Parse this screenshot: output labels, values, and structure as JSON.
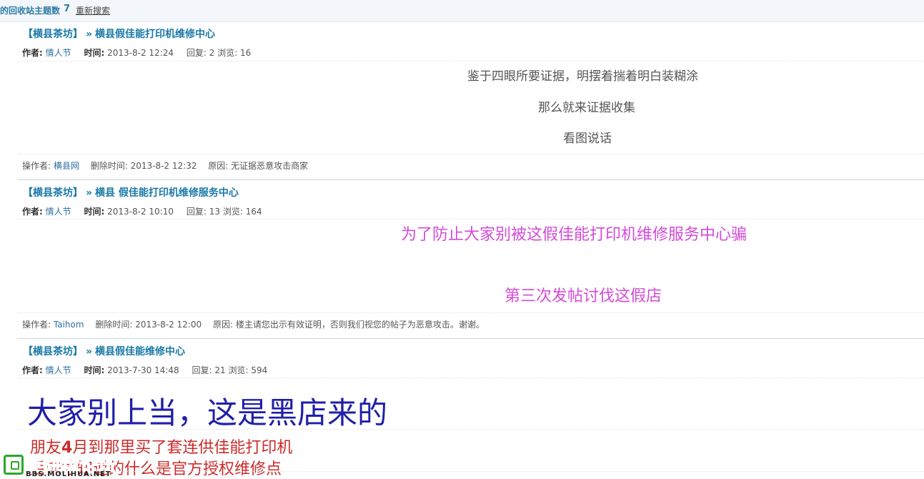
{
  "topbar": {
    "count_label": "的回收站主题数",
    "count": "7",
    "research_link": "重新搜索"
  },
  "labels": {
    "author": "作者:",
    "time": "时间:",
    "replies": "回复:",
    "views": "浏览:",
    "operator": "操作者:",
    "delete_time": "删除时间:",
    "reason": "原因:",
    "arrow": "»"
  },
  "posts": [
    {
      "board": "【横县茶坊】",
      "title": "横县假佳能打印机维修中心",
      "author": "情人节",
      "time": "2013-8-2 12:24",
      "replies": "2",
      "views": "16",
      "body": [
        "鉴于四眼所要证据，明摆着揣着明白装糊涂",
        "那么就来证据收集",
        "看图说话"
      ],
      "operator": "横县网",
      "delete_time": "2013-8-2 12:32",
      "reason": "无证据恶意攻击商家"
    },
    {
      "board": "【横县茶坊】",
      "title": "横县 假佳能打印机维修服务中心",
      "author": "情人节",
      "time": "2013-8-2 10:10",
      "replies": "13",
      "views": "164",
      "body": [
        "为了防止大家别被这假佳能打印机维修服务中心骗",
        "第三次发帖讨伐这假店"
      ],
      "operator": "Taihom",
      "delete_time": "2013-8-2 12:00",
      "reason": "楼主请您出示有效证明，否则我们视您的帖子为恶意攻击。谢谢。"
    },
    {
      "board": "【横县茶坊】",
      "title": "横县假佳能维修中心",
      "author": "情人节",
      "time": "2013-7-30 14:48",
      "replies": "21",
      "views": "594",
      "body": [
        "大家别上当，这是黑店来的",
        "朋友",
        "4",
        "月到那里买了套连供佳能打印机",
        "后来才知道的什么是官方授权维修点"
      ]
    }
  ],
  "watermark": {
    "name": "茉莉花论坛",
    "url": "BBS.MOLIHUA.NET"
  }
}
